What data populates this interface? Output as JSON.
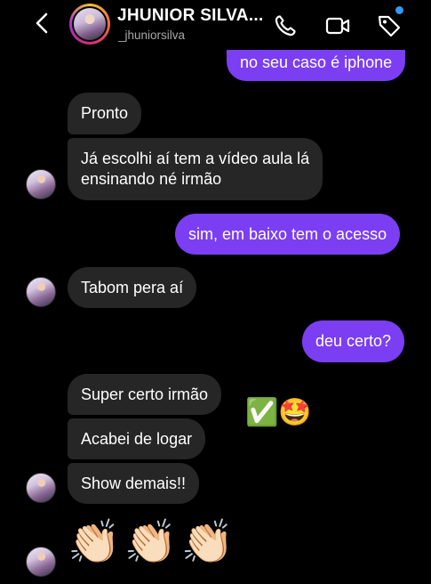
{
  "header": {
    "contact_name": "JHUNIOR SILVA...",
    "username": "_jhuniorsilva"
  },
  "messages": [
    {
      "sender": "me",
      "text": "no seu caso é iphone"
    },
    {
      "sender": "contact",
      "text": "Pronto"
    },
    {
      "sender": "contact",
      "lines": [
        "Já escolhi aí tem a vídeo aula lá",
        "ensinando né irmão"
      ]
    },
    {
      "sender": "me",
      "text": "sim, em baixo tem o acesso"
    },
    {
      "sender": "contact",
      "text": "Tabom pera aí"
    },
    {
      "sender": "me",
      "text": "deu certo?"
    },
    {
      "sender": "contact",
      "text": "Super certo irmão"
    },
    {
      "sender": "contact",
      "text": "Acabei de logar"
    },
    {
      "sender": "contact",
      "text": "Show demais!!"
    },
    {
      "sender": "contact",
      "text": "👏🏻👏🏻👏🏻"
    }
  ],
  "reaction_emoji": "✅🤩",
  "colors": {
    "background": "#000000",
    "incoming_bubble": "#262626",
    "outgoing_bubble": "#7b3ef2",
    "notification_dot": "#3897f0"
  },
  "icons": [
    "back-arrow-icon",
    "phone-icon",
    "video-camera-icon",
    "tag-icon"
  ]
}
